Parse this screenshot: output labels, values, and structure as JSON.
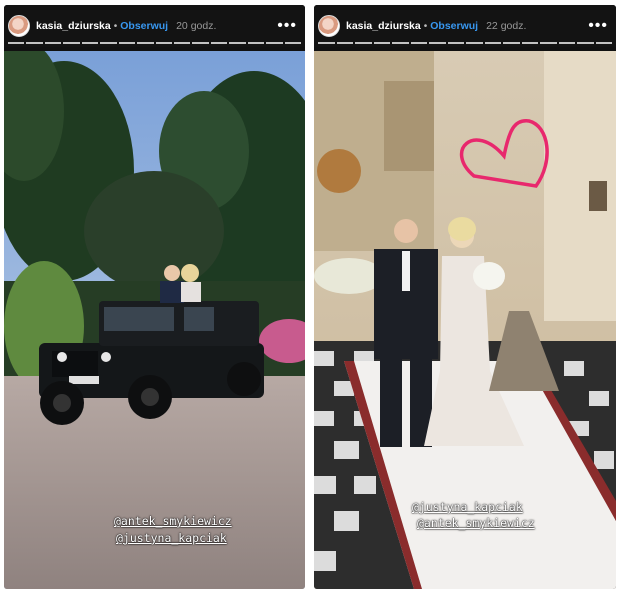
{
  "stories": [
    {
      "username": "kasia_dziurska",
      "separator": "•",
      "follow_label": "Obserwuj",
      "time": "20 godz.",
      "more_icon": "more-horizontal-icon",
      "tags": [
        "@antek_smykiewicz",
        "@justyna_kapciak"
      ]
    },
    {
      "username": "kasia_dziurska",
      "separator": "•",
      "follow_label": "Obserwuj",
      "time": "22 godz.",
      "more_icon": "more-horizontal-icon",
      "tags": [
        "@justyna_kapciak",
        "@antek_smykiewicz"
      ]
    }
  ],
  "colors": {
    "follow": "#3897f0",
    "heart": "#e8286d"
  }
}
